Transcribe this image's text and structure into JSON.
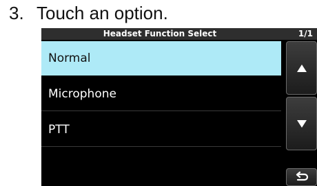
{
  "instruction": {
    "step_number": "3.",
    "text": "Touch an option."
  },
  "screen": {
    "title": "Headset Function Select",
    "page_indicator": "1/1",
    "options": [
      {
        "label": "Normal",
        "selected": true
      },
      {
        "label": "Microphone",
        "selected": false
      },
      {
        "label": "PTT",
        "selected": false
      }
    ],
    "buttons": {
      "up_icon": "triangle-up-icon",
      "down_icon": "triangle-down-icon",
      "back_icon": "return-arrow-icon"
    },
    "colors": {
      "selected_background": "#aeeaf7",
      "screen_background": "#000000"
    }
  }
}
